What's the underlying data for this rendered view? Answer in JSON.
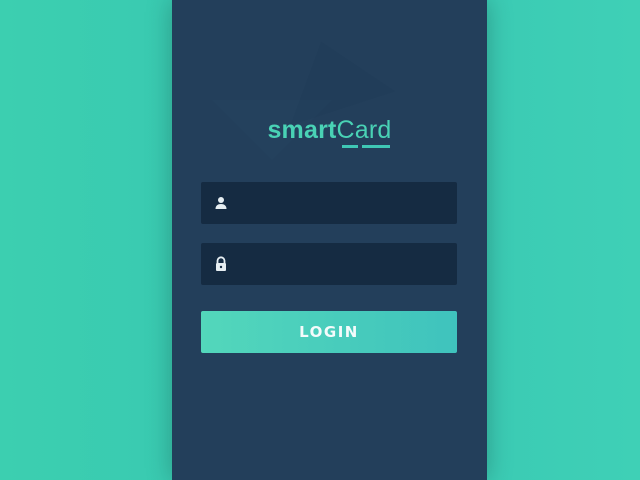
{
  "app": {
    "logo_part1": "smart",
    "logo_part2": "Card"
  },
  "form": {
    "username": {
      "value": "",
      "placeholder": "",
      "icon": "user-icon"
    },
    "password": {
      "value": "",
      "placeholder": "",
      "icon": "lock-icon"
    },
    "login_label": "LOGIN"
  },
  "colors": {
    "background": "#3ccfb0",
    "panel": "#233f5b",
    "field": "#152b42",
    "accent": "#49d2b5"
  }
}
